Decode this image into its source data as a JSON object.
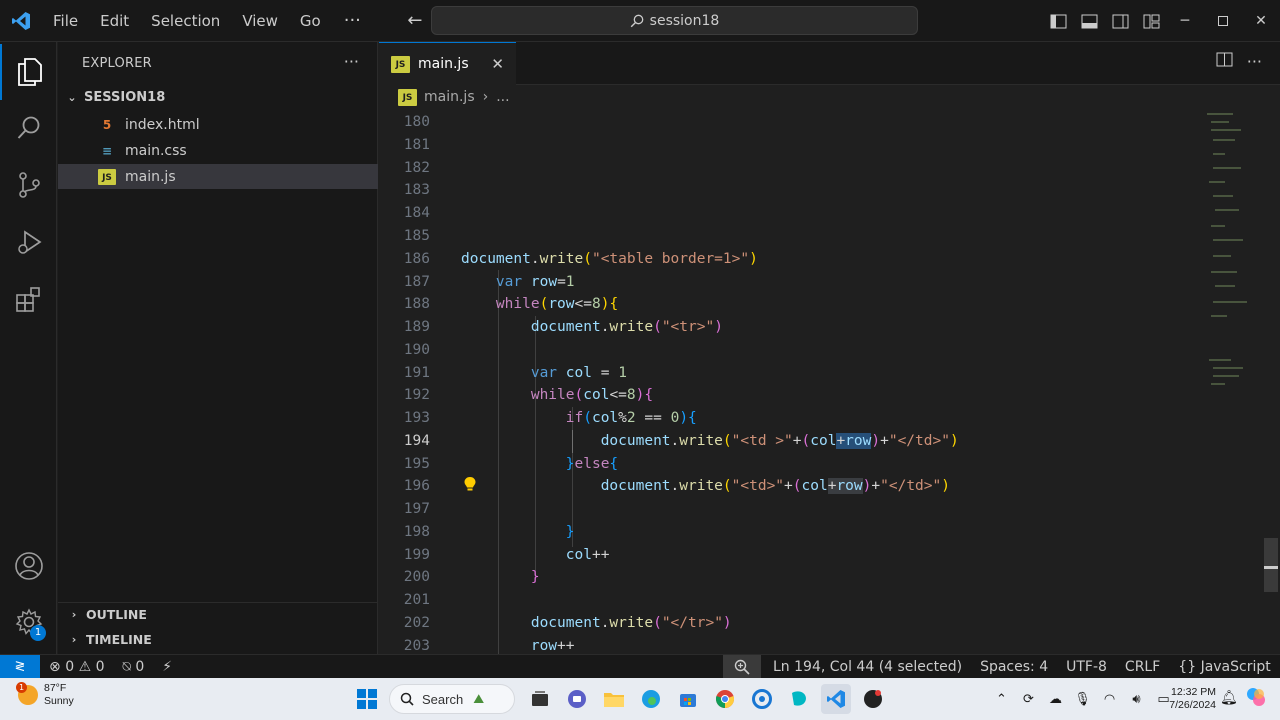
{
  "titlebar": {
    "menu": [
      "File",
      "Edit",
      "Selection",
      "View",
      "Go"
    ],
    "more": "···",
    "search_text": "session18"
  },
  "sidebar": {
    "title": "EXPLORER",
    "more": "···",
    "folder": "SESSION18",
    "files": [
      {
        "name": "index.html",
        "icon": "html-file-icon"
      },
      {
        "name": "main.css",
        "icon": "css-file-icon"
      },
      {
        "name": "main.js",
        "icon": "js-file-icon",
        "selected": true
      }
    ],
    "outline_label": "OUTLINE",
    "timeline_label": "TIMELINE",
    "settings_badge": "1"
  },
  "editor": {
    "tab_label": "main.js",
    "tab_badge": "JS",
    "breadcrumb_file": "main.js",
    "breadcrumb_more": "...",
    "lines": [
      {
        "n": "180"
      },
      {
        "n": "181"
      },
      {
        "n": "182"
      },
      {
        "n": "183"
      },
      {
        "n": "184"
      },
      {
        "n": "185"
      },
      {
        "n": "186"
      },
      {
        "n": "187"
      },
      {
        "n": "188"
      },
      {
        "n": "189"
      },
      {
        "n": "190"
      },
      {
        "n": "191"
      },
      {
        "n": "192"
      },
      {
        "n": "193"
      },
      {
        "n": "194"
      },
      {
        "n": "195"
      },
      {
        "n": "196"
      },
      {
        "n": "197"
      },
      {
        "n": "198"
      },
      {
        "n": "199"
      },
      {
        "n": "200"
      },
      {
        "n": "201"
      },
      {
        "n": "202"
      },
      {
        "n": "203"
      }
    ],
    "current_line": "194"
  },
  "statusbar": {
    "errors": "0",
    "warnings": "0",
    "ports": "0",
    "cursor": "Ln 194, Col 44 (4 selected)",
    "spaces": "Spaces: 4",
    "encoding": "UTF-8",
    "eol": "CRLF",
    "language": "JavaScript"
  },
  "taskbar": {
    "weather_temp": "87°F",
    "weather_cond": "Sunny",
    "weather_alert": "1",
    "search_label": "Search",
    "time": "12:32 PM",
    "date": "7/26/2024"
  },
  "colors": {
    "accent": "#0078d4",
    "js_badge": "#cbcb41"
  }
}
